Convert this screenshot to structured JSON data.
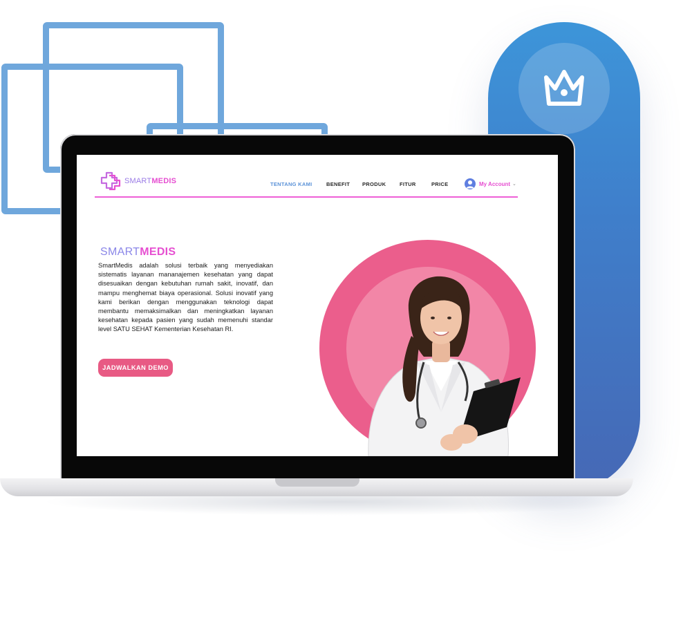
{
  "brand": {
    "part1": "SMART",
    "part2": "MEDIS"
  },
  "nav": {
    "items": [
      {
        "label": "TENTANG KAMI",
        "active": true
      },
      {
        "label": "BENEFIT",
        "active": false
      },
      {
        "label": "PRODUK",
        "active": false
      },
      {
        "label": "FITUR",
        "active": false
      },
      {
        "label": "PRICE",
        "active": false
      }
    ],
    "account_label": "My Account",
    "account_chevron": "⌄"
  },
  "hero": {
    "title_part1": "SMART",
    "title_part2": "MEDIS",
    "description": "SmartMedis adalah solusi terbaik yang menyediakan sistematis layanan mananajemen kesehatan yang dapat disesuaikan dengan kebutuhan rumah sakit, inovatif, dan mampu menghemat biaya operasional. Solusi inovatif yang kami berikan dengan menggunakan teknologi dapat membantu memaksimalkan dan meningkatkan layanan kesehatan kepada pasien yang sudah memenuhi standar level SATU SEHAT Kementerian Kesehatan RI.",
    "cta_label": "JADWALKAN DEMO"
  },
  "icons": {
    "crown": "crown-icon",
    "logo": "medical-cross-logo-icon",
    "account": "user-avatar-icon"
  },
  "colors": {
    "accent_pink": "#e64fd1",
    "button_pink": "#e85a84",
    "circle_pink": "#eb5e8c",
    "nav_active": "#5a92d8",
    "pill_blue": "#3f7fcb",
    "frame_blue": "#6fa7dc"
  }
}
